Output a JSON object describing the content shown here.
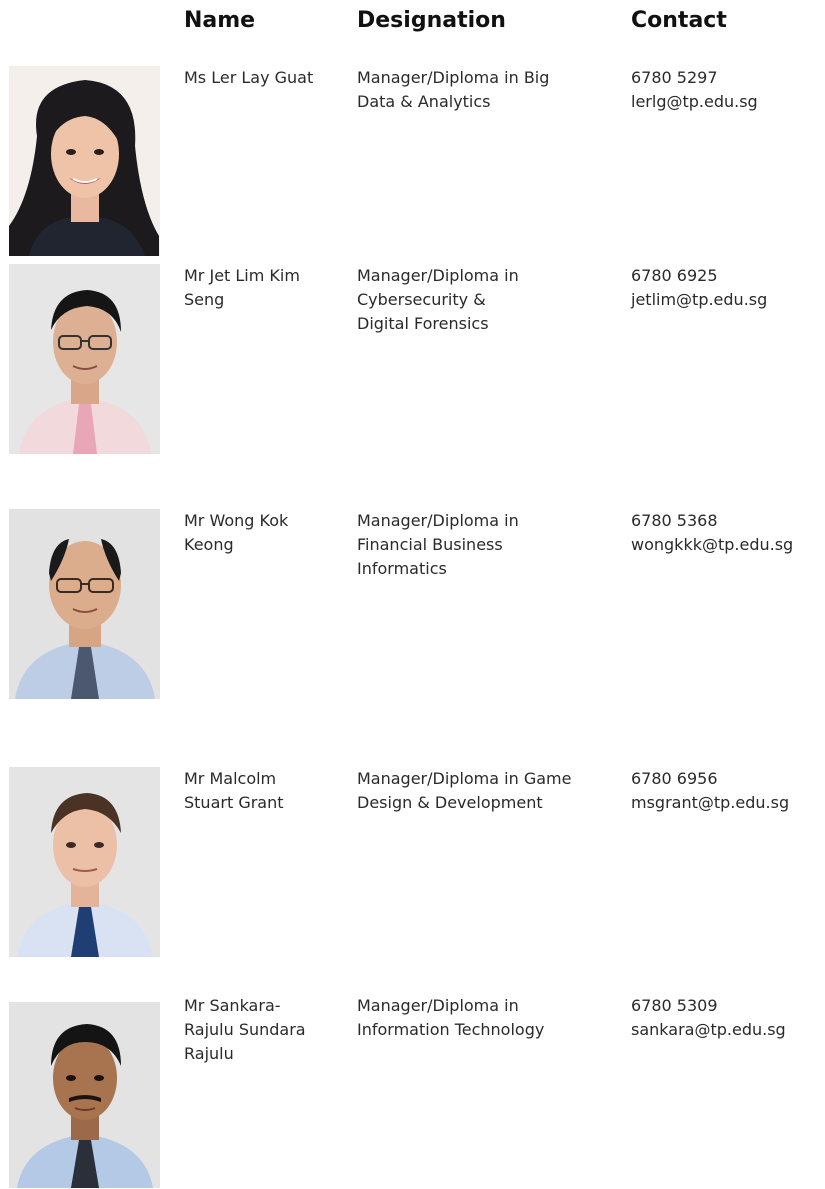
{
  "headers": {
    "name": "Name",
    "designation": "Designation",
    "contact": "Contact"
  },
  "staff": [
    {
      "name_lines": [
        "Ms Ler Lay Guat"
      ],
      "designation_lines": [
        "Manager/Diploma in Big",
        "Data & Analytics"
      ],
      "phone": "6780 5297",
      "email": "lerlg@tp.edu.sg"
    },
    {
      "name_lines": [
        "Mr Jet Lim Kim",
        "Seng"
      ],
      "designation_lines": [
        "Manager/Diploma in",
        "Cybersecurity &",
        "Digital Forensics"
      ],
      "phone": "6780 6925",
      "email": "jetlim@tp.edu.sg"
    },
    {
      "name_lines": [
        "Mr Wong Kok",
        "Keong"
      ],
      "designation_lines": [
        "Manager/Diploma in",
        "Financial Business",
        "Informatics"
      ],
      "phone": "6780 5368",
      "email": "wongkkk@tp.edu.sg"
    },
    {
      "name_lines": [
        "Mr Malcolm",
        "Stuart Grant"
      ],
      "designation_lines": [
        "Manager/Diploma in Game",
        "Design & Development"
      ],
      "phone": "6780 6956",
      "email": "msgrant@tp.edu.sg"
    },
    {
      "name_lines": [
        "Mr Sankara-",
        "Rajulu Sundara",
        "Rajulu"
      ],
      "designation_lines": [
        "Manager/Diploma in",
        "Information Technology"
      ],
      "phone": "6780 5309",
      "email": "sankara@tp.edu.sg"
    }
  ]
}
